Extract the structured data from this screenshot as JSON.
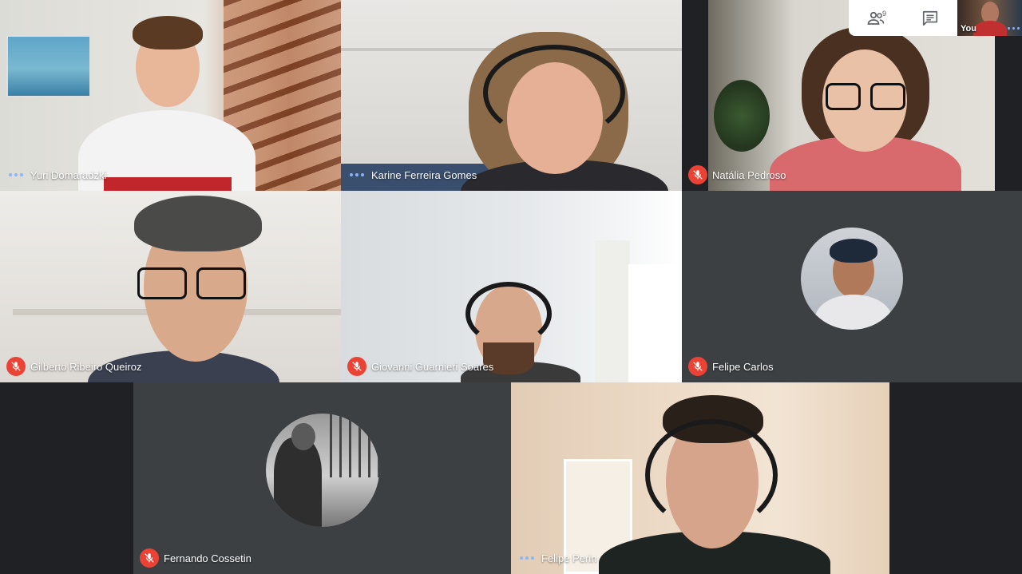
{
  "toolbar": {
    "participants_count": "9",
    "self_label": "You"
  },
  "participants": [
    {
      "name": "Yuri Domaradzki",
      "status": "speaking"
    },
    {
      "name": "Karine Ferreira Gomes",
      "status": "speaking"
    },
    {
      "name": "Natália Pedroso",
      "status": "muted"
    },
    {
      "name": "Gilberto Ribeiro Queiroz",
      "status": "muted"
    },
    {
      "name": "Giovanni Guarnieri Soares",
      "status": "muted"
    },
    {
      "name": "Felipe Carlos",
      "status": "muted"
    },
    {
      "name": "Fernando Cossetin",
      "status": "muted"
    },
    {
      "name": "Felipe Perin",
      "status": "speaking"
    }
  ],
  "colors": {
    "background": "#202124",
    "muted_badge": "#ea4335",
    "speaking_dots": "#8ab4f8"
  },
  "icons": {
    "participants": "people-icon",
    "chat": "chat-icon",
    "muted": "mic-off-icon",
    "speaking": "audio-dots-icon"
  }
}
